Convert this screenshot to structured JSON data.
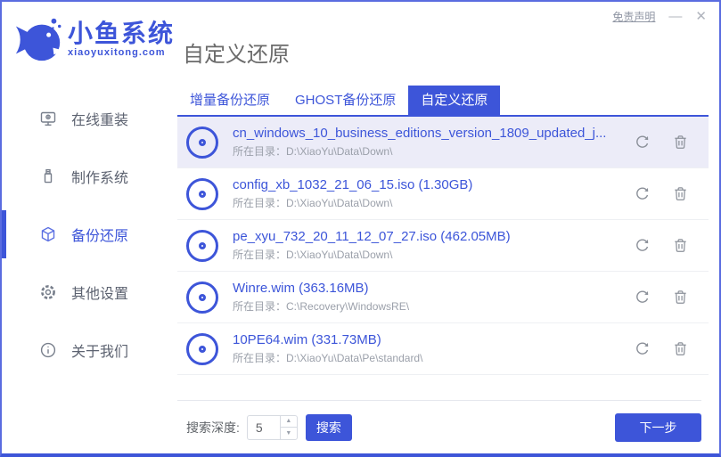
{
  "colors": {
    "accent": "#3d55d9",
    "selected_row_bg": "#ececf8",
    "title_gray": "#6a6a6a"
  },
  "header": {
    "logo_title": "小鱼系统",
    "logo_subtitle": "xiaoyuxitong.com",
    "page_title": "自定义还原",
    "disclaimer": "免责声明",
    "minimize": "—",
    "close": "✕"
  },
  "sidebar": {
    "items": [
      {
        "label": "在线重装",
        "icon": "monitor-icon",
        "active": false
      },
      {
        "label": "制作系统",
        "icon": "usb-icon",
        "active": false
      },
      {
        "label": "备份还原",
        "icon": "backup-box-icon",
        "active": true
      },
      {
        "label": "其他设置",
        "icon": "gear-icon",
        "active": false
      },
      {
        "label": "关于我们",
        "icon": "info-icon",
        "active": false
      }
    ]
  },
  "tabs": [
    {
      "label": "增量备份还原",
      "active": false
    },
    {
      "label": "GHOST备份还原",
      "active": false
    },
    {
      "label": "自定义还原",
      "active": true
    }
  ],
  "list": {
    "path_label": "所在目录：",
    "files": [
      {
        "name": "cn_windows_10_business_editions_version_1809_updated_j...",
        "path": "D:\\XiaoYu\\Data\\Down\\",
        "selected": true
      },
      {
        "name": "config_xb_1032_21_06_15.iso (1.30GB)",
        "path": "D:\\XiaoYu\\Data\\Down\\",
        "selected": false
      },
      {
        "name": "pe_xyu_732_20_11_12_07_27.iso (462.05MB)",
        "path": "D:\\XiaoYu\\Data\\Down\\",
        "selected": false
      },
      {
        "name": "Winre.wim (363.16MB)",
        "path": "C:\\Recovery\\WindowsRE\\",
        "selected": false
      },
      {
        "name": "10PE64.wim (331.73MB)",
        "path": "D:\\XiaoYu\\Data\\Pe\\standard\\",
        "selected": false
      }
    ]
  },
  "footer": {
    "search_depth_label": "搜索深度:",
    "search_depth_value": "5",
    "search_button": "搜索",
    "next_button": "下一步"
  }
}
